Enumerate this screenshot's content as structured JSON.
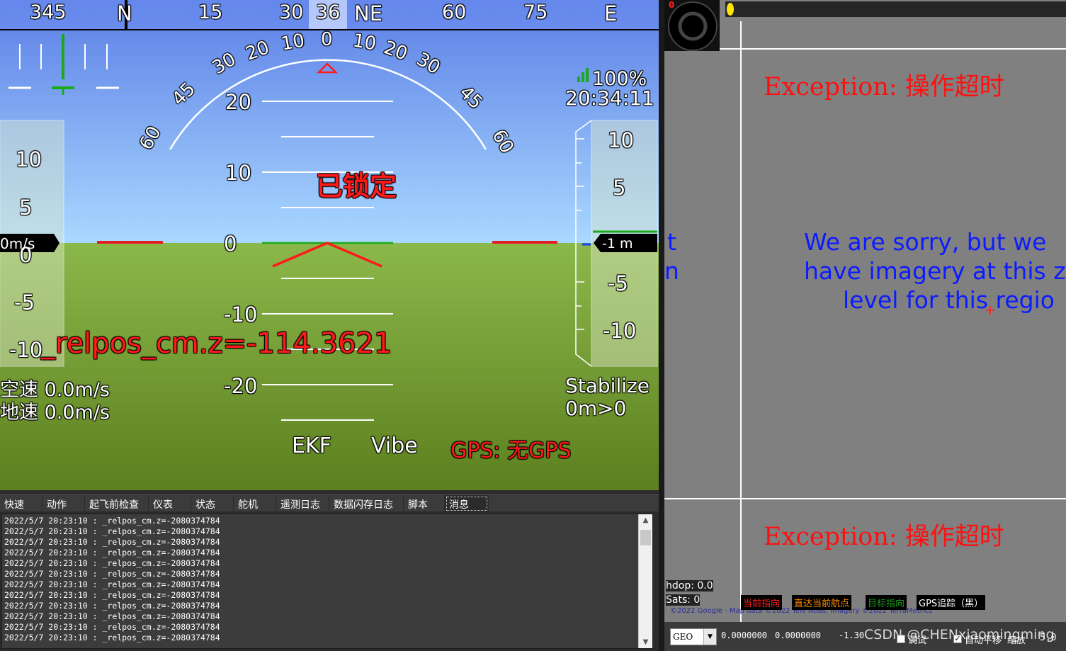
{
  "hud": {
    "compass": {
      "labels": [
        "345",
        "N",
        "15",
        "30",
        "36",
        "NE",
        "60",
        "75",
        "E"
      ]
    },
    "roll_labels": [
      "60",
      "45",
      "30",
      "20",
      "10",
      "0",
      "10",
      "20",
      "30",
      "45",
      "60"
    ],
    "pitch_labels": [
      "20",
      "10",
      "0",
      "-10",
      "-20"
    ],
    "battery": "100%",
    "time": "20:34:11",
    "status": "已锁定",
    "debug_text": "_relpos_cm.z=-114.3621",
    "speed_tape": {
      "labels": [
        "10",
        "5",
        "0",
        "-5",
        "-10"
      ],
      "current": "0m/s"
    },
    "alt_tape": {
      "labels": [
        "10",
        "5",
        "0",
        "-5",
        "-10"
      ],
      "current": "-1 m"
    },
    "airspeed": "空速 0.0m/s",
    "groundspeed": "地速 0.0m/s",
    "mode": "Stabilize",
    "wp": "0m>0",
    "ekf": "EKF",
    "vibe": "Vibe",
    "gps": "GPS: 无GPS",
    "colors": {
      "sky_top": "#5b7fe6",
      "sky_bottom": "#a9d8ff",
      "ground_top": "#8bb84a",
      "ground_bottom": "#5c7f1f",
      "red": "#ff1a1a",
      "green": "#1aaa1a"
    }
  },
  "tabs": [
    {
      "label": "快速"
    },
    {
      "label": "动作"
    },
    {
      "label": "起飞前检查"
    },
    {
      "label": "仪表"
    },
    {
      "label": "状态"
    },
    {
      "label": "舵机"
    },
    {
      "label": "遥测日志"
    },
    {
      "label": "数据闪存日志"
    },
    {
      "label": "脚本"
    },
    {
      "label": "消息"
    }
  ],
  "messages": [
    "2022/5/7 20:23:10 : _relpos_cm.z=-2080374784",
    "2022/5/7 20:23:10 : _relpos_cm.z=-2080374784",
    "2022/5/7 20:23:10 : _relpos_cm.z=-2080374784",
    "2022/5/7 20:23:10 : _relpos_cm.z=-2080374784",
    "2022/5/7 20:23:10 : _relpos_cm.z=-2080374784",
    "2022/5/7 20:23:10 : _relpos_cm.z=-2080374784",
    "2022/5/7 20:23:10 : _relpos_cm.z=-2080374784",
    "2022/5/7 20:23:10 : _relpos_cm.z=-2080374784",
    "2022/5/7 20:23:10 : _relpos_cm.z=-2080374784",
    "2022/5/7 20:23:10 : _relpos_cm.z=-2080374784",
    "2022/5/7 20:23:10 : _relpos_cm.z=-2080374784",
    "2022/5/7 20:23:10 : _relpos_cm.z=-2080374784"
  ],
  "map": {
    "zoom_marker": "0",
    "exception_top": "Exception: 操作超时",
    "exception_bottom": "Exception: 操作超时",
    "sorry_line1": "We are sorry, but we",
    "sorry_line2": "have imagery at this z",
    "sorry_line3": "level for this regio",
    "left_edge_1": "t",
    "left_edge_2": "n",
    "hdop": "hdop: 0.0",
    "sats": "Sats: 0",
    "copyright": "©2022 Google - Map data ©2022 Tele Atlas, Imagery ©2022 TerraMetrics",
    "legend": {
      "heading": "当前指向",
      "waypoint": "直达当前航点",
      "target": "目标指向",
      "gps_track": "GPS追踪（黑）"
    },
    "legend_colors": {
      "heading": "#ff2020",
      "waypoint": "#ff8c00",
      "target": "#1a9a1a",
      "gps_track": "#ffffff"
    }
  },
  "bottom_bar": {
    "coord_system": "GEO",
    "lat": "0.0000000",
    "lng": "0.0000000",
    "alt": "-1.30",
    "watermark": "CSDN @CHENxiaomingming",
    "debug_label": "调试",
    "auto_pan_label": "自动平移",
    "zoom_label": "缩放",
    "zoom_value": "5.0"
  }
}
